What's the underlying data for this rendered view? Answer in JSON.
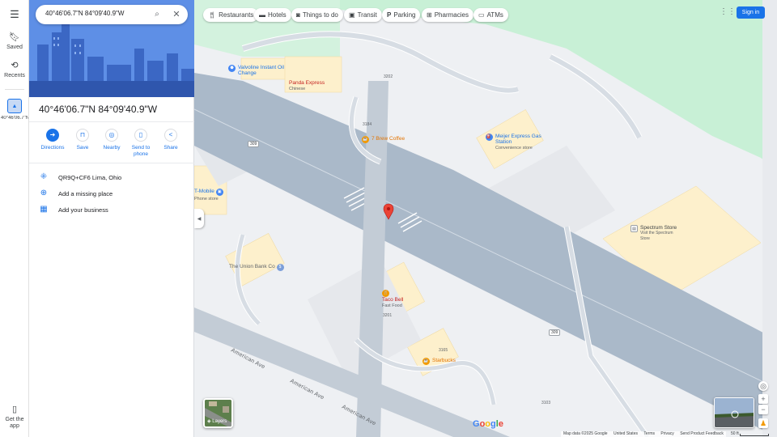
{
  "search": {
    "value": "40°46'06.7\"N 84°09'40.9\"W"
  },
  "rail": {
    "saved": "Saved",
    "recents": "Recents",
    "current": "40°46'06.7\"N...",
    "get_app": "Get the app"
  },
  "chips": [
    {
      "icon": "fork-knife-icon",
      "label": "Restaurants"
    },
    {
      "icon": "bed-icon",
      "label": "Hotels"
    },
    {
      "icon": "camera-icon",
      "label": "Things to do"
    },
    {
      "icon": "train-icon",
      "label": "Transit"
    },
    {
      "icon": "parking-icon",
      "label": "Parking"
    },
    {
      "icon": "pharmacy-icon",
      "label": "Pharmacies"
    },
    {
      "icon": "atm-icon",
      "label": "ATMs"
    }
  ],
  "header": {
    "signin": "Sign in"
  },
  "place": {
    "title": "40°46'06.7\"N 84°09'40.9\"W",
    "actions": {
      "directions": "Directions",
      "save": "Save",
      "nearby": "Nearby",
      "send": "Send to phone",
      "share": "Share"
    },
    "info": {
      "pluscode": "QR9Q+CF6 Lima, Ohio",
      "missing": "Add a missing place",
      "business": "Add your business"
    }
  },
  "map": {
    "pois": {
      "valvoline": "Valvoline Instant Oil Change",
      "panda": "Panda Express",
      "panda_sub": "Chinese",
      "brew": "7 Brew Coffee",
      "meijer": "Meijer Express Gas Station",
      "meijer_sub": "Convenience store",
      "tmobile": "T-Mobile",
      "tmobile_sub": "Phone store",
      "union": "The Union Bank Co",
      "tacobell": "Taco Bell",
      "tacobell_sub": "Fast Food",
      "starbucks": "Starbucks",
      "spectrum": "Spectrum Store",
      "spectrum_sub": "Visit the Spectrum Store"
    },
    "roads": {
      "r3202": "3202",
      "r3184": "3184",
      "r3201": "3201",
      "r3165": "3165",
      "r3103": "3103",
      "r309a": "309",
      "r309b": "309",
      "ave1": "American Ave",
      "ave2": "American Ave",
      "ave3": "American Ave"
    },
    "layers": "Layers",
    "logo": "Google",
    "footer": {
      "mapdata": "Map data ©2025 Google",
      "country": "United States",
      "terms": "Terms",
      "privacy": "Privacy",
      "feedback": "Send Product Feedback"
    },
    "scale": "50 ft"
  },
  "colors": {
    "accent": "#1a73e8",
    "road": "#aab9c9",
    "green": "#c6efd2",
    "building": "#fdf0cc",
    "marker": "#ea4335"
  }
}
